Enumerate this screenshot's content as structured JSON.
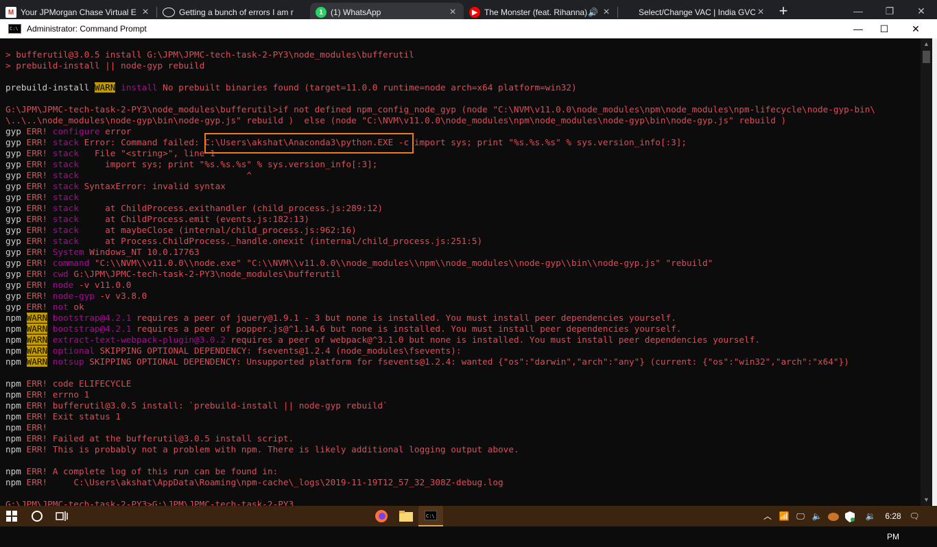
{
  "browser": {
    "tabs": [
      {
        "favicon": "gmail-icon",
        "title": "Your JPMorgan Chase Virtual E",
        "active": false
      },
      {
        "favicon": "github-icon",
        "title": "Getting a bunch of errors I am r",
        "active": false
      },
      {
        "favicon": "whatsapp-icon",
        "title": "(1) WhatsApp",
        "active": true
      },
      {
        "favicon": "youtube-icon",
        "title": "The Monster (feat. Rihanna)",
        "active": false
      },
      {
        "favicon": "page-icon",
        "title": "Select/Change VAC | India GVC",
        "active": false
      }
    ],
    "new_tab": "+"
  },
  "window": {
    "title": "Administrator: Command Prompt",
    "minimize": "—",
    "maximize": "☐",
    "close": "✕"
  },
  "console": {
    "lines": [
      "> bufferutil@3.0.5 install G:\\JPM\\JPMC-tech-task-2-PY3\\node_modules\\bufferutil",
      "> prebuild-install || node-gyp rebuild",
      "",
      "prebuild-install |WARN| install No prebuilt binaries found (target=11.0.0 runtime=node arch=x64 platform=win32)",
      "",
      "G:\\JPM\\JPMC-tech-task-2-PY3\\node_modules\\bufferutil>if not defined npm_config_node_gyp (node \"C:\\NVM\\v11.0.0\\node_modules\\npm\\node_modules\\npm-lifecycle\\node-gyp-bin\\",
      "\\..\\..\\node_modules\\node-gyp\\bin\\node-gyp.js\" rebuild )  else (node \"C:\\NVM\\v11.0.0\\node_modules\\npm\\node_modules\\node-gyp\\bin\\node-gyp.js\" rebuild )",
      "gyp ERR! configure error",
      "gyp ERR! stack Error: Command failed: C:\\Users\\akshat\\Anaconda3\\python.EXE -c import sys; print \"%s.%s.%s\" % sys.version_info[:3];",
      "gyp ERR! stack   File \"<string>\", line 1",
      "gyp ERR! stack     import sys; print \"%s.%s.%s\" % sys.version_info[:3];",
      "gyp ERR! stack                                ^",
      "gyp ERR! stack SyntaxError: invalid syntax",
      "gyp ERR! stack",
      "gyp ERR! stack     at ChildProcess.exithandler (child_process.js:289:12)",
      "gyp ERR! stack     at ChildProcess.emit (events.js:182:13)",
      "gyp ERR! stack     at maybeClose (internal/child_process.js:962:16)",
      "gyp ERR! stack     at Process.ChildProcess._handle.onexit (internal/child_process.js:251:5)",
      "gyp ERR! System Windows_NT 10.0.17763",
      "gyp ERR! command \"C:\\\\NVM\\\\v11.0.0\\\\node.exe\" \"C:\\\\NVM\\\\v11.0.0\\\\node_modules\\\\npm\\\\node_modules\\\\node-gyp\\\\bin\\\\node-gyp.js\" \"rebuild\"",
      "gyp ERR! cwd G:\\JPM\\JPMC-tech-task-2-PY3\\node_modules\\bufferutil",
      "gyp ERR! node -v v11.0.0",
      "gyp ERR! node-gyp -v v3.8.0",
      "gyp ERR! not ok",
      "npm |WARN| bootstrap@4.2.1 requires a peer of jquery@1.9.1 - 3 but none is installed. You must install peer dependencies yourself.",
      "npm |WARN| bootstrap@4.2.1 requires a peer of popper.js@^1.14.6 but none is installed. You must install peer dependencies yourself.",
      "npm |WARN| extract-text-webpack-plugin@3.0.2 requires a peer of webpack@^3.1.0 but none is installed. You must install peer dependencies yourself.",
      "npm |WARN| optional SKIPPING OPTIONAL DEPENDENCY: fsevents@1.2.4 (node_modules\\fsevents):",
      "npm |WARN| notsup SKIPPING OPTIONAL DEPENDENCY: Unsupported platform for fsevents@1.2.4: wanted {\"os\":\"darwin\",\"arch\":\"any\"} (current: {\"os\":\"win32\",\"arch\":\"x64\"})",
      "",
      "npm ERR! code ELIFECYCLE",
      "npm ERR! errno 1",
      "npm ERR! bufferutil@3.0.5 install: `prebuild-install || node-gyp rebuild`",
      "npm ERR! Exit status 1",
      "npm ERR!",
      "npm ERR! Failed at the bufferutil@3.0.5 install script.",
      "npm ERR! This is probably not a problem with npm. There is likely additional logging output above.",
      "",
      "npm ERR! A complete log of this run can be found in:",
      "npm ERR!     C:\\Users\\akshat\\AppData\\Roaming\\npm-cache\\_logs\\2019-11-19T12_57_32_308Z-debug.log",
      "",
      "G:\\JPM\\JPMC-tech-task-2-PY3>G:\\JPM\\JPMC-tech-task-2-PY3"
    ]
  },
  "taskbar": {
    "apps": [
      "start-icon",
      "search-icon",
      "task-view-icon",
      "firefox-icon",
      "file-explorer-icon",
      "command-prompt-icon"
    ],
    "clock": "6:28 PM"
  },
  "colors": {
    "console_bg": "#0c0c0c",
    "error_red": "#e74856",
    "warn_bg": "#c19c00",
    "highlight_border": "#f07a1e"
  }
}
